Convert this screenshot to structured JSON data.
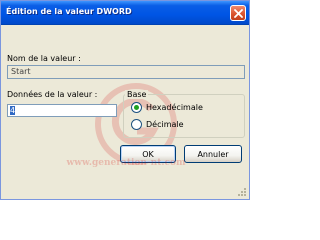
{
  "window": {
    "title": "Édition de la valeur DWORD",
    "accent": "#0055e5"
  },
  "value_name": {
    "label": "Nom de la valeur :",
    "value": "Start"
  },
  "value_data": {
    "label": "Données de la valeur :",
    "value": "4"
  },
  "base": {
    "legend": "Base",
    "options": [
      {
        "label": "Hexadécimale",
        "selected": true
      },
      {
        "label": "Décimale",
        "selected": false
      }
    ]
  },
  "buttons": {
    "ok": "OK",
    "cancel": "Annuler"
  },
  "watermark": {
    "text": "www.generation-nt.com",
    "color": "#d61414"
  }
}
